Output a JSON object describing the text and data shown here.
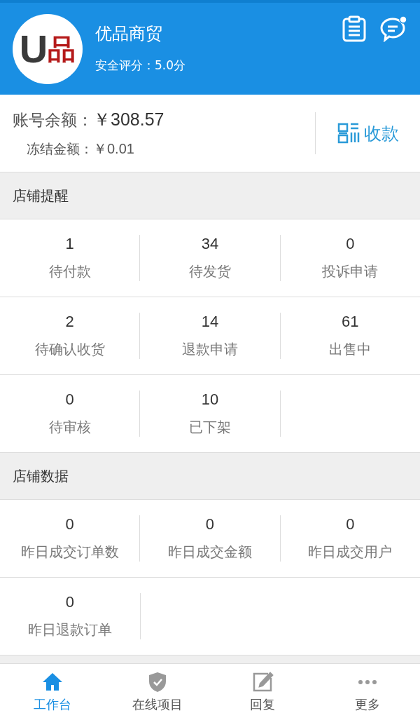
{
  "header": {
    "logo": {
      "letter": "U",
      "mark": "品"
    },
    "shop_name": "优品商贸",
    "rating": "安全评分：5.0分",
    "message_unread": true
  },
  "account": {
    "balance_label": "账号余额：",
    "balance": "￥308.57",
    "frozen_label": "冻结金额：",
    "frozen": "￥0.01",
    "collect_button": "收款"
  },
  "sections": [
    {
      "title": "店铺提醒",
      "cells": [
        {
          "value": "1",
          "label": "待付款"
        },
        {
          "value": "34",
          "label": "待发货"
        },
        {
          "value": "0",
          "label": "投诉申请"
        },
        {
          "value": "2",
          "label": "待确认收货"
        },
        {
          "value": "14",
          "label": "退款申请"
        },
        {
          "value": "61",
          "label": "出售中"
        },
        {
          "value": "0",
          "label": "待审核"
        },
        {
          "value": "10",
          "label": "已下架"
        }
      ]
    },
    {
      "title": "店铺数据",
      "cells": [
        {
          "value": "0",
          "label": "昨日成交订单数"
        },
        {
          "value": "0",
          "label": "昨日成交金额"
        },
        {
          "value": "0",
          "label": "昨日成交用户"
        },
        {
          "value": "0",
          "label": "昨日退款订单"
        }
      ]
    }
  ],
  "tab_bar": [
    {
      "kind": "home",
      "label": "工作台",
      "selected": true
    },
    {
      "kind": "shield",
      "label": "在线项目",
      "selected": false
    },
    {
      "kind": "edit",
      "label": "回复",
      "selected": false
    },
    {
      "kind": "more",
      "label": "更多",
      "selected": false
    }
  ]
}
